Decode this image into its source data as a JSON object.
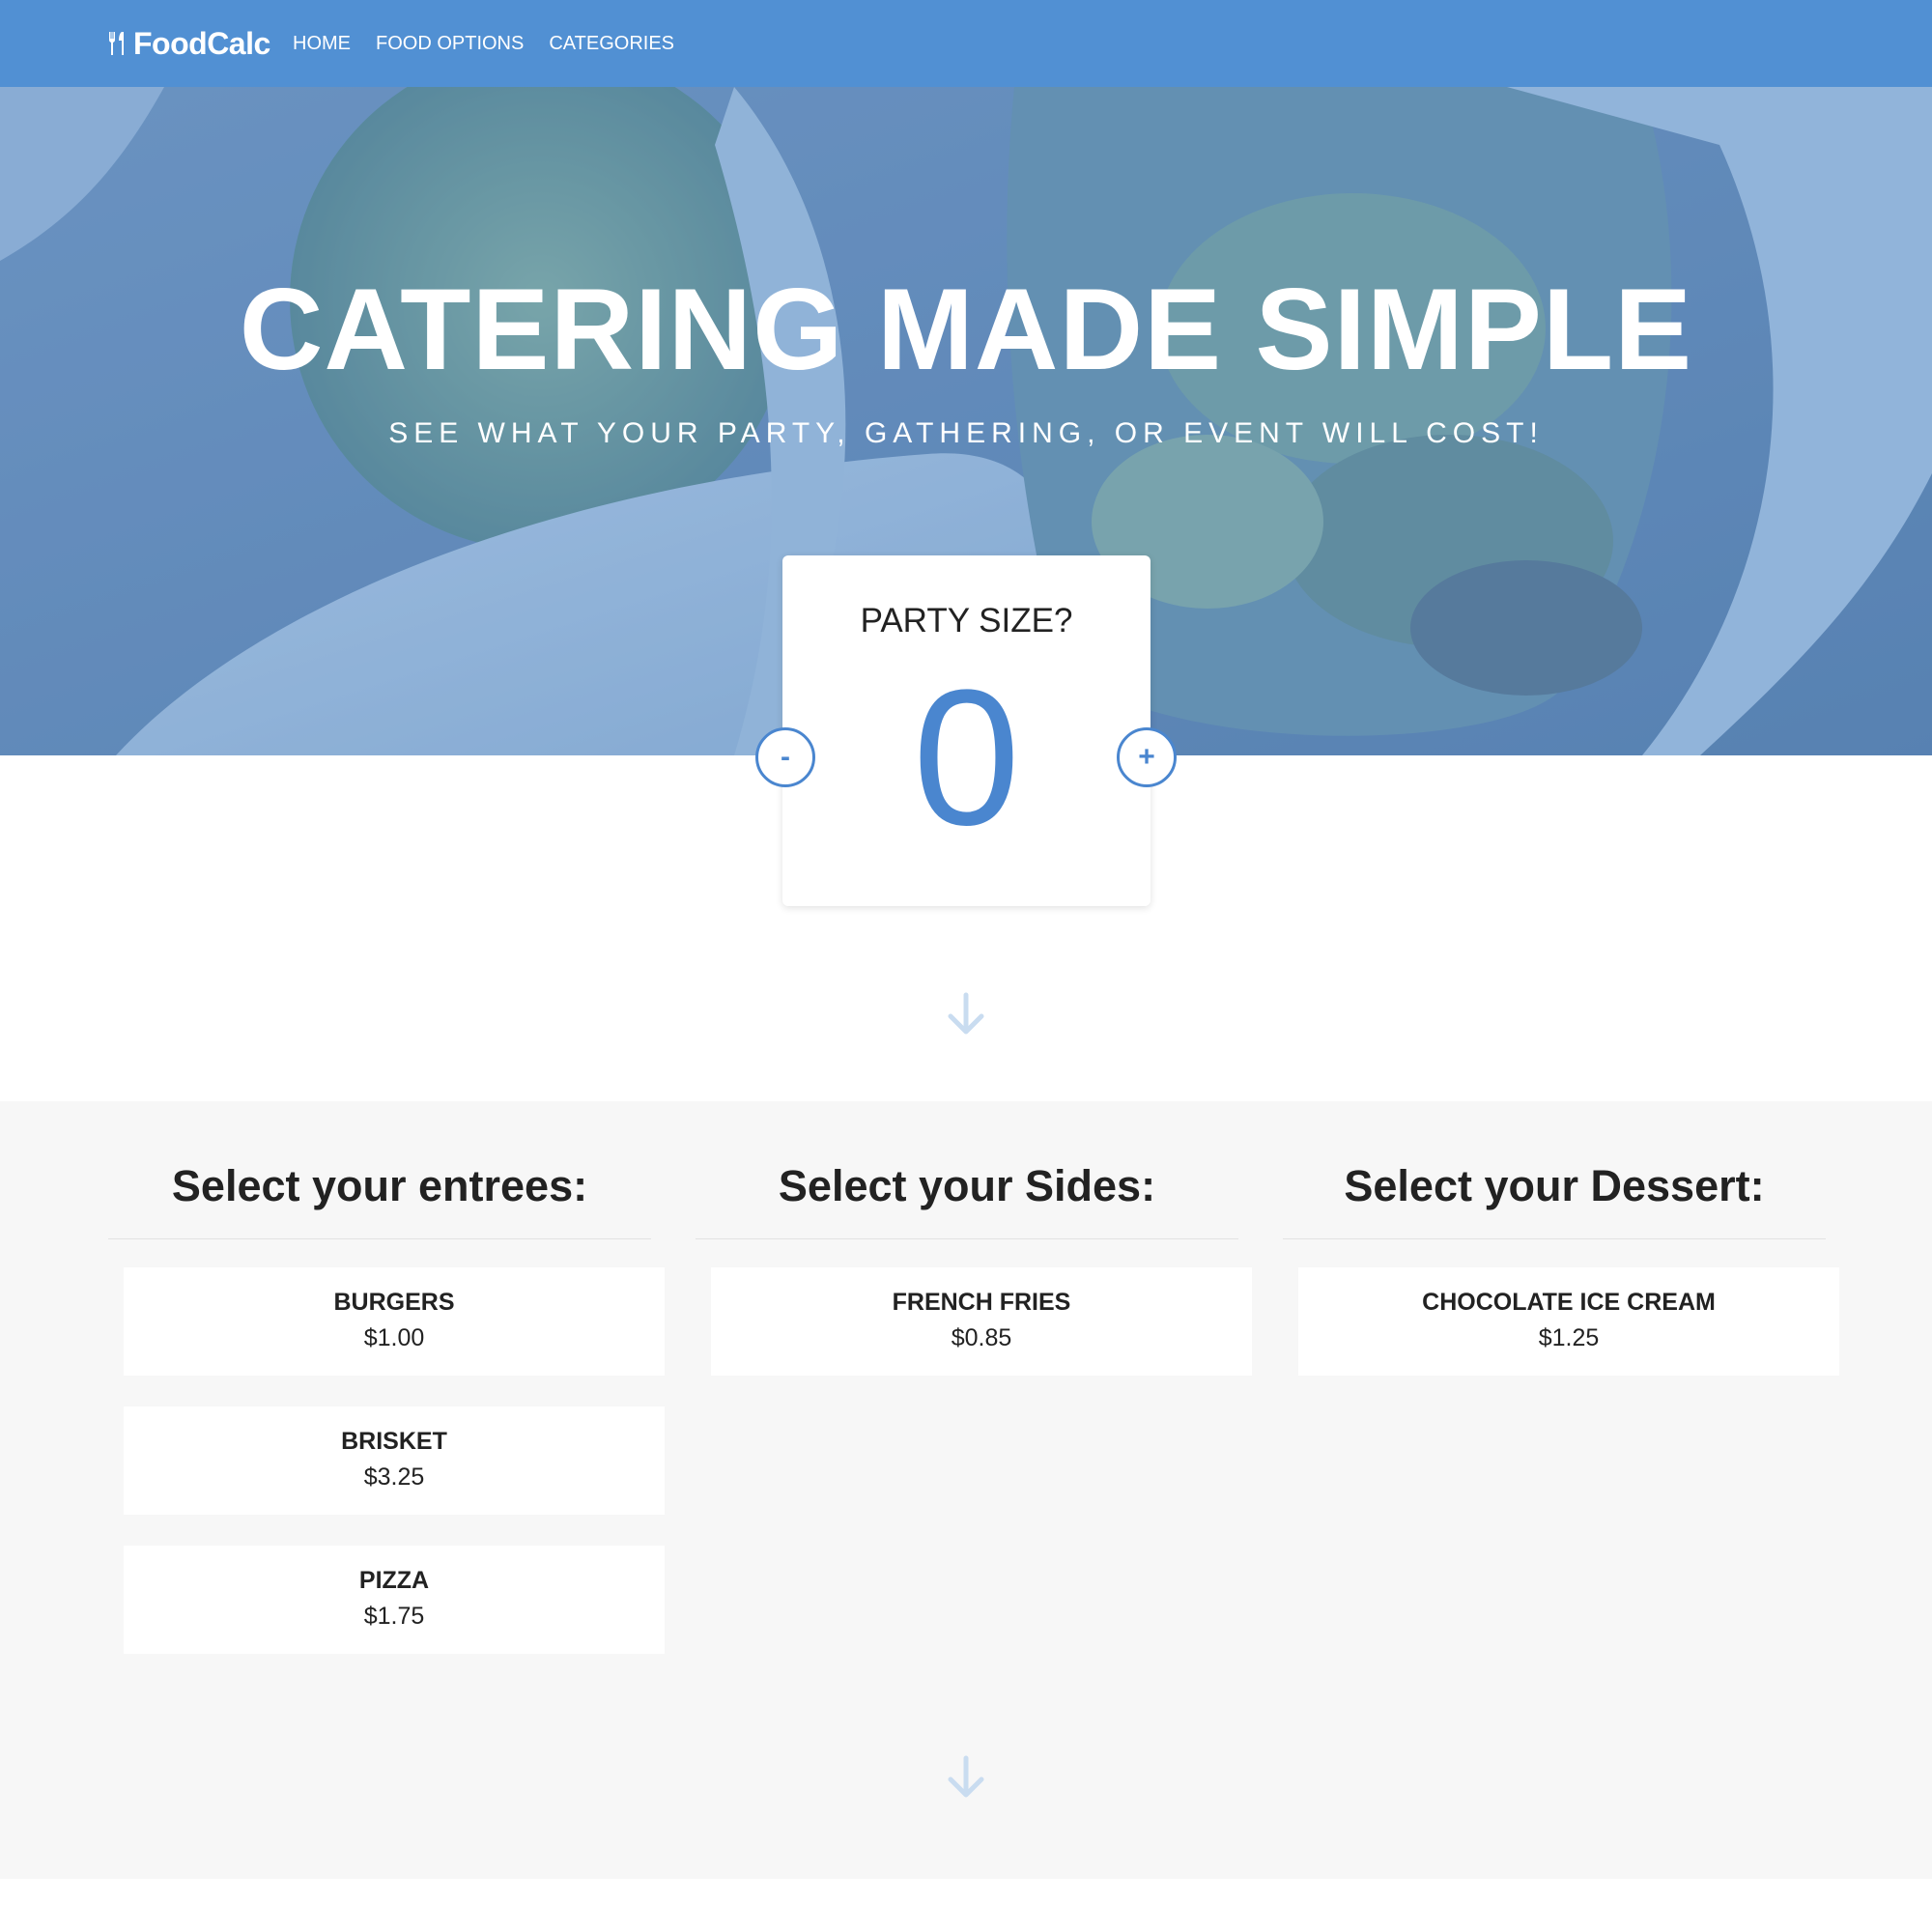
{
  "nav": {
    "brand": "FoodCalc",
    "brand_icon": "utensils-icon",
    "links": [
      "HOME",
      "FOOD OPTIONS",
      "CATEGORIES"
    ]
  },
  "hero": {
    "title": "CATERING MADE SIMPLE",
    "subtitle": "SEE WHAT YOUR PARTY, GATHERING, OR EVENT WILL COST!"
  },
  "party": {
    "label": "PARTY SIZE?",
    "value": "0",
    "minus_label": "-",
    "plus_label": "+"
  },
  "menu": {
    "entrees": {
      "heading": "Select your entrees:",
      "items": [
        {
          "name": "BURGERS",
          "price": "$1.00"
        },
        {
          "name": "BRISKET",
          "price": "$3.25"
        },
        {
          "name": "PIZZA",
          "price": "$1.75"
        }
      ]
    },
    "sides": {
      "heading": "Select your Sides:",
      "items": [
        {
          "name": "FRENCH FRIES",
          "price": "$0.85"
        }
      ]
    },
    "dessert": {
      "heading": "Select your Dessert:",
      "items": [
        {
          "name": "CHOCOLATE ICE CREAM",
          "price": "$1.25"
        }
      ]
    }
  },
  "colors": {
    "brand_blue": "#5190d3",
    "accent_blue": "#4a86cf",
    "menu_bg": "#f7f7f7",
    "arrow": "#c9dcf0"
  }
}
